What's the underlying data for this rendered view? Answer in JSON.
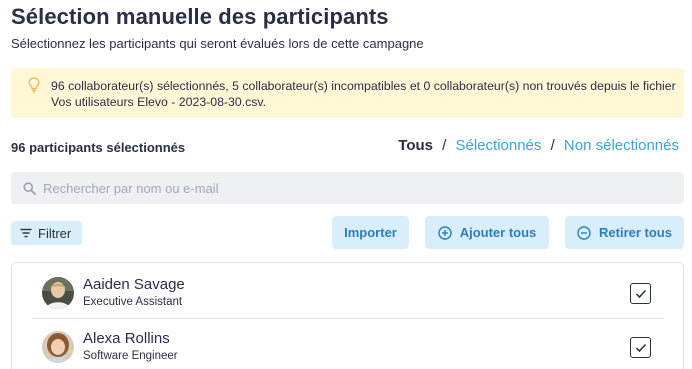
{
  "header": {
    "title": "Sélection manuelle des participants",
    "subtitle": "Sélectionnez les participants qui seront évalués lors de cette campagne"
  },
  "banner": {
    "icon": "lightbulb-icon",
    "text": "96 collaborateur(s) sélectionnés, 5 collaborateur(s) incompatibles et 0 collaborateur(s) non trouvés depuis le fichier Vos utilisateurs Elevo - 2023-08-30.csv.",
    "bg_color": "#fff7d6"
  },
  "selection": {
    "count_label": "96 participants sélectionnés",
    "filters": {
      "all": "Tous",
      "selected": "Sélectionnés",
      "unselected": "Non sélectionnés",
      "separator": "/"
    }
  },
  "search": {
    "placeholder": "Rechercher par nom ou e-mail",
    "value": ""
  },
  "toolbar": {
    "filter_label": "Filtrer",
    "import_label": "Importer",
    "add_all_label": "Ajouter tous",
    "remove_all_label": "Retirer tous"
  },
  "participants": [
    {
      "name": "Aaiden Savage",
      "role": "Executive Assistant",
      "checked": true
    },
    {
      "name": "Alexa Rollins",
      "role": "Software Engineer",
      "checked": true
    }
  ],
  "colors": {
    "accent": "#3aa3d9",
    "button_bg": "#d9eefb",
    "button_text": "#2a7fbf",
    "text": "#2a2f45"
  }
}
